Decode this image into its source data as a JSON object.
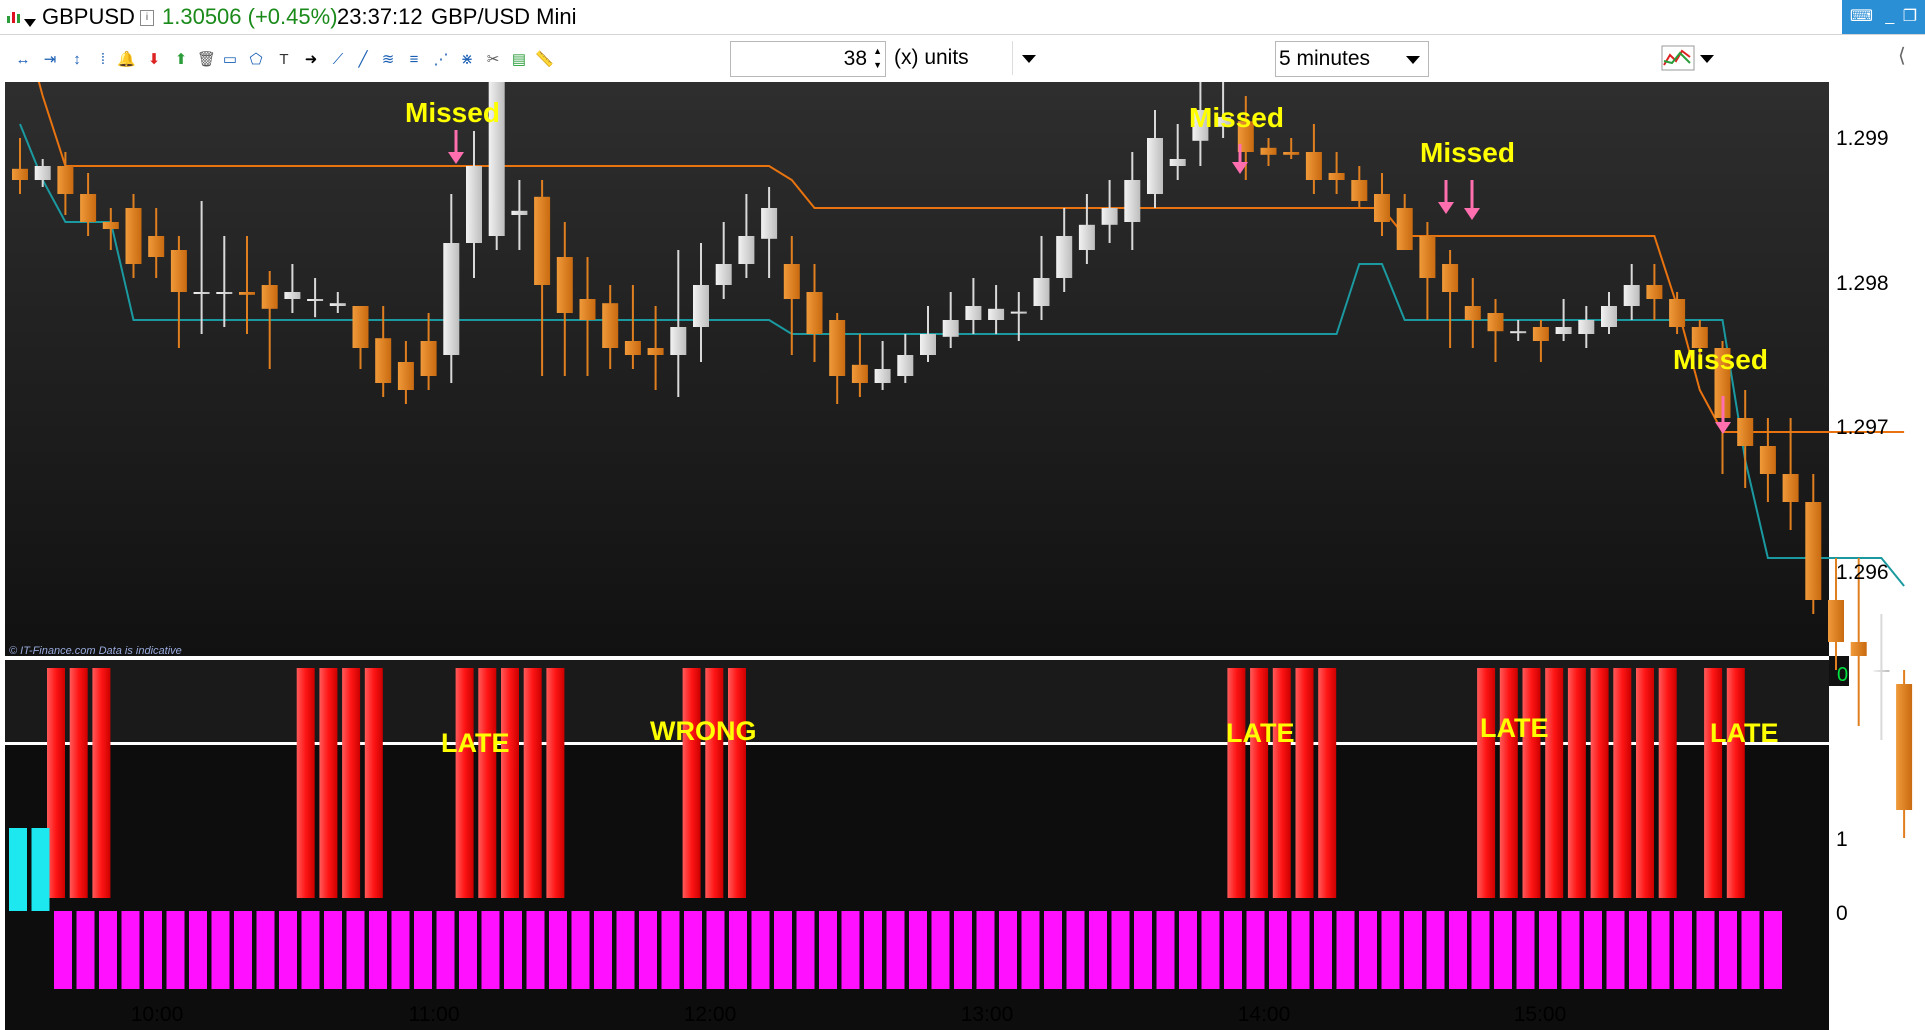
{
  "title": {
    "symbol": "GBPUSD",
    "price_change": "1.30506 (+0.45%)",
    "time": "23:37:12",
    "instrument": "GBP/USD Mini"
  },
  "toolbar": {
    "units_value": "38",
    "units_label": "(x) units",
    "interval_value": "5 minutes"
  },
  "colors": {
    "up_candle": "#d9d9d9",
    "down_candle": "#e07f1f",
    "upper_band": "#e8730f",
    "lower_band": "#1a9aa0",
    "signal_bar": "#ff2020",
    "hist_positive": "#1de8f0",
    "hist_negative": "#ff10ff",
    "annotation": "#ffff00",
    "arrow": "#ff6fb0"
  },
  "chart_data": {
    "type": "candlestick",
    "instrument": "GBP/USD Mini",
    "interval": "5 minutes",
    "y_ticks": [
      "1.299",
      "1.298",
      "1.297",
      "1.296"
    ],
    "ylim": [
      1.2953,
      1.2994
    ],
    "x_ticks": [
      "10:00",
      "11:00",
      "12:00",
      "13:00",
      "14:00",
      "15:00"
    ],
    "watermark": "© IT-Finance.com  Data is indicative",
    "candles": [
      [
        1.29878,
        1.299,
        1.2986,
        1.2987
      ],
      [
        1.2987,
        1.29885,
        1.29865,
        1.2988
      ],
      [
        1.2988,
        1.2989,
        1.29845,
        1.2986
      ],
      [
        1.2986,
        1.29875,
        1.2983,
        1.2984
      ],
      [
        1.2984,
        1.2985,
        1.2982,
        1.29835
      ],
      [
        1.2985,
        1.2986,
        1.298,
        1.2981
      ],
      [
        1.2983,
        1.2985,
        1.298,
        1.29815
      ],
      [
        1.2982,
        1.2983,
        1.2975,
        1.2979
      ],
      [
        1.2979,
        1.29855,
        1.2976,
        1.2979
      ],
      [
        1.2979,
        1.2983,
        1.29765,
        1.2979
      ],
      [
        1.2979,
        1.2983,
        1.2976,
        1.29788
      ],
      [
        1.29795,
        1.29805,
        1.29735,
        1.29778
      ],
      [
        1.29785,
        1.2981,
        1.29775,
        1.2979
      ],
      [
        1.29785,
        1.298,
        1.29772,
        1.29785
      ],
      [
        1.2978,
        1.2979,
        1.29775,
        1.29782
      ],
      [
        1.2978,
        1.2978,
        1.29735,
        1.2975
      ],
      [
        1.29757,
        1.2978,
        1.29715,
        1.29725
      ],
      [
        1.2974,
        1.29755,
        1.2971,
        1.2972
      ],
      [
        1.29755,
        1.29775,
        1.2972,
        1.2973
      ],
      [
        1.29745,
        1.2986,
        1.29725,
        1.29825
      ],
      [
        1.29825,
        1.29905,
        1.298,
        1.2988
      ],
      [
        1.2983,
        1.2995,
        1.2982,
        1.2994
      ],
      [
        1.29845,
        1.2987,
        1.2982,
        1.29848
      ],
      [
        1.29858,
        1.2987,
        1.2973,
        1.29795
      ],
      [
        1.29815,
        1.2984,
        1.2973,
        1.29775
      ],
      [
        1.29785,
        1.29815,
        1.2973,
        1.2977
      ],
      [
        1.29782,
        1.29795,
        1.29735,
        1.2975
      ],
      [
        1.29755,
        1.29795,
        1.29735,
        1.29745
      ],
      [
        1.2975,
        1.2978,
        1.2972,
        1.29745
      ],
      [
        1.29745,
        1.2982,
        1.29715,
        1.29765
      ],
      [
        1.29765,
        1.29825,
        1.2974,
        1.29795
      ],
      [
        1.29795,
        1.2984,
        1.29785,
        1.2981
      ],
      [
        1.2981,
        1.2986,
        1.298,
        1.2983
      ],
      [
        1.29828,
        1.29865,
        1.298,
        1.2985
      ],
      [
        1.2981,
        1.2983,
        1.29745,
        1.29785
      ],
      [
        1.2979,
        1.2981,
        1.2974,
        1.2976
      ],
      [
        1.2977,
        1.29775,
        1.2971,
        1.2973
      ],
      [
        1.29738,
        1.2976,
        1.29715,
        1.29725
      ],
      [
        1.29725,
        1.29755,
        1.2972,
        1.29735
      ],
      [
        1.2973,
        1.2976,
        1.29725,
        1.29745
      ],
      [
        1.29745,
        1.2978,
        1.2974,
        1.2976
      ],
      [
        1.29758,
        1.2979,
        1.2975,
        1.2977
      ],
      [
        1.2977,
        1.298,
        1.2976,
        1.2978
      ],
      [
        1.2977,
        1.29795,
        1.2976,
        1.29778
      ],
      [
        1.29776,
        1.2979,
        1.29755,
        1.29776
      ],
      [
        1.2978,
        1.2983,
        1.2977,
        1.298
      ],
      [
        1.298,
        1.2985,
        1.2979,
        1.2983
      ],
      [
        1.2982,
        1.2986,
        1.2981,
        1.29838
      ],
      [
        1.29838,
        1.2987,
        1.29825,
        1.2985
      ],
      [
        1.2984,
        1.2989,
        1.2982,
        1.2987
      ],
      [
        1.2986,
        1.2992,
        1.2985,
        1.299
      ],
      [
        1.2988,
        1.2991,
        1.2987,
        1.29885
      ],
      [
        1.29898,
        1.2996,
        1.2988,
        1.2992
      ],
      [
        1.29908,
        1.2994,
        1.299,
        1.29915
      ],
      [
        1.29912,
        1.2993,
        1.2987,
        1.2989
      ],
      [
        1.29893,
        1.299,
        1.2988,
        1.29888
      ],
      [
        1.2989,
        1.299,
        1.29885,
        1.29888
      ],
      [
        1.2989,
        1.2991,
        1.2986,
        1.2987
      ],
      [
        1.29875,
        1.2989,
        1.2986,
        1.2987
      ],
      [
        1.2987,
        1.2988,
        1.2985,
        1.29855
      ],
      [
        1.2986,
        1.29875,
        1.2983,
        1.2984
      ],
      [
        1.2985,
        1.2986,
        1.2982,
        1.2982
      ],
      [
        1.2983,
        1.2984,
        1.2977,
        1.298
      ],
      [
        1.2981,
        1.2982,
        1.2975,
        1.2979
      ],
      [
        1.2978,
        1.298,
        1.2975,
        1.2977
      ],
      [
        1.29775,
        1.29785,
        1.2974,
        1.29762
      ],
      [
        1.29762,
        1.2977,
        1.29755,
        1.29762
      ],
      [
        1.29765,
        1.2977,
        1.2974,
        1.29755
      ],
      [
        1.2976,
        1.29785,
        1.29755,
        1.29765
      ],
      [
        1.2976,
        1.2978,
        1.2975,
        1.2977
      ],
      [
        1.29765,
        1.2979,
        1.2976,
        1.2978
      ],
      [
        1.2978,
        1.2981,
        1.2977,
        1.29795
      ],
      [
        1.29795,
        1.2981,
        1.2977,
        1.29785
      ],
      [
        1.29785,
        1.2979,
        1.2976,
        1.29765
      ],
      [
        1.29765,
        1.2977,
        1.2974,
        1.2975
      ],
      [
        1.2975,
        1.29755,
        1.2966,
        1.297
      ],
      [
        1.297,
        1.2972,
        1.2965,
        1.2968
      ],
      [
        1.2968,
        1.297,
        1.2964,
        1.2966
      ],
      [
        1.2966,
        1.297,
        1.2962,
        1.2964
      ],
      [
        1.2964,
        1.2966,
        1.2956,
        1.2957
      ],
      [
        1.2957,
        1.296,
        1.2952,
        1.2954
      ],
      [
        1.2954,
        1.296,
        1.2948,
        1.2953
      ],
      [
        1.2952,
        1.2956,
        1.2947,
        1.2952
      ],
      [
        1.2951,
        1.2952,
        1.294,
        1.2942
      ]
    ],
    "upper_band": [
      1.2999,
      1.2993,
      1.2988,
      1.2988,
      1.2988,
      1.2988,
      1.2988,
      1.2988,
      1.2988,
      1.2988,
      1.2988,
      1.2988,
      1.2988,
      1.2988,
      1.2988,
      1.2988,
      1.2988,
      1.2988,
      1.2988,
      1.2988,
      1.2988,
      1.2988,
      1.2988,
      1.2988,
      1.2988,
      1.2988,
      1.2988,
      1.2988,
      1.2988,
      1.2988,
      1.2988,
      1.2988,
      1.2988,
      1.2988,
      1.2987,
      1.2985,
      1.2985,
      1.2985,
      1.2985,
      1.2985,
      1.2985,
      1.2985,
      1.2985,
      1.2985,
      1.2985,
      1.2985,
      1.2985,
      1.2985,
      1.2985,
      1.2985,
      1.2985,
      1.2985,
      1.2985,
      1.2985,
      1.2985,
      1.2985,
      1.2985,
      1.2985,
      1.2985,
      1.2985,
      1.2985,
      1.2983,
      1.2983,
      1.2983,
      1.2983,
      1.2983,
      1.2983,
      1.2983,
      1.2983,
      1.2983,
      1.2983,
      1.2983,
      1.2983,
      1.2978,
      1.2972,
      1.2969,
      1.2969,
      1.2969,
      1.2969,
      1.2969,
      1.2969,
      1.2969,
      1.2969,
      1.2969
    ],
    "lower_band": [
      1.2991,
      1.2987,
      1.2984,
      1.2984,
      1.2984,
      1.2977,
      1.2977,
      1.2977,
      1.2977,
      1.2977,
      1.2977,
      1.2977,
      1.2977,
      1.2977,
      1.2977,
      1.2977,
      1.2977,
      1.2977,
      1.2977,
      1.2977,
      1.2977,
      1.2977,
      1.2977,
      1.2977,
      1.2977,
      1.2977,
      1.2977,
      1.2977,
      1.2977,
      1.2977,
      1.2977,
      1.2977,
      1.2977,
      1.2977,
      1.2976,
      1.2976,
      1.2976,
      1.2976,
      1.2976,
      1.2976,
      1.2976,
      1.2976,
      1.2976,
      1.2976,
      1.2976,
      1.2976,
      1.2976,
      1.2976,
      1.2976,
      1.2976,
      1.2976,
      1.2976,
      1.2976,
      1.2976,
      1.2976,
      1.2976,
      1.2976,
      1.2976,
      1.2976,
      1.2981,
      1.2981,
      1.2977,
      1.2977,
      1.2977,
      1.2977,
      1.2977,
      1.2977,
      1.2977,
      1.2977,
      1.2977,
      1.2977,
      1.2977,
      1.2977,
      1.2977,
      1.2977,
      1.2977,
      1.2967,
      1.296,
      1.296,
      1.296,
      1.296,
      1.296,
      1.296,
      1.2958
    ],
    "annotations": [
      "Missed",
      "Missed",
      "Missed",
      "Missed"
    ],
    "panel2": {
      "y_tick": "0",
      "labels": [
        "LATE",
        "WRONG",
        "LATE",
        "LATE",
        "LATE"
      ],
      "signal_bars": [
        1,
        1,
        1,
        0,
        0,
        0,
        0,
        0,
        0,
        0,
        0,
        1,
        1,
        1,
        1,
        0,
        0,
        0,
        1,
        1,
        1,
        1,
        1,
        0,
        0,
        0,
        0,
        0,
        1,
        1,
        1,
        0,
        0,
        0,
        0,
        0,
        0,
        0,
        0,
        0,
        0,
        0,
        0,
        0,
        0,
        0,
        0,
        0,
        0,
        0,
        0,
        0,
        1,
        1,
        1,
        1,
        1,
        0,
        0,
        0,
        0,
        0,
        0,
        1,
        1,
        1,
        1,
        1,
        1,
        1,
        1,
        1,
        0,
        1,
        1,
        0,
        0,
        0,
        0,
        0,
        0,
        0,
        0,
        0
      ]
    },
    "panel3": {
      "y_ticks": [
        "1",
        "0"
      ],
      "values": [
        1,
        1,
        -1,
        -1,
        -1,
        -1,
        -1,
        -1,
        -1,
        -1,
        -1,
        -1,
        -1,
        -1,
        -1,
        -1,
        -1,
        -1,
        -1,
        -1,
        -1,
        -1,
        -1,
        -1,
        -1,
        -1,
        -1,
        -1,
        -1,
        -1,
        -1,
        -1,
        -1,
        -1,
        -1,
        -1,
        -1,
        -1,
        -1,
        -1,
        -1,
        -1,
        -1,
        -1,
        -1,
        -1,
        -1,
        -1,
        -1,
        -1,
        -1,
        -1,
        -1,
        -1,
        -1,
        -1,
        -1,
        -1,
        -1,
        -1,
        -1,
        -1,
        -1,
        -1,
        -1,
        -1,
        -1,
        -1,
        -1,
        -1,
        -1,
        -1,
        -1,
        -1,
        -1,
        -1,
        -1,
        -1,
        -1
      ]
    }
  }
}
